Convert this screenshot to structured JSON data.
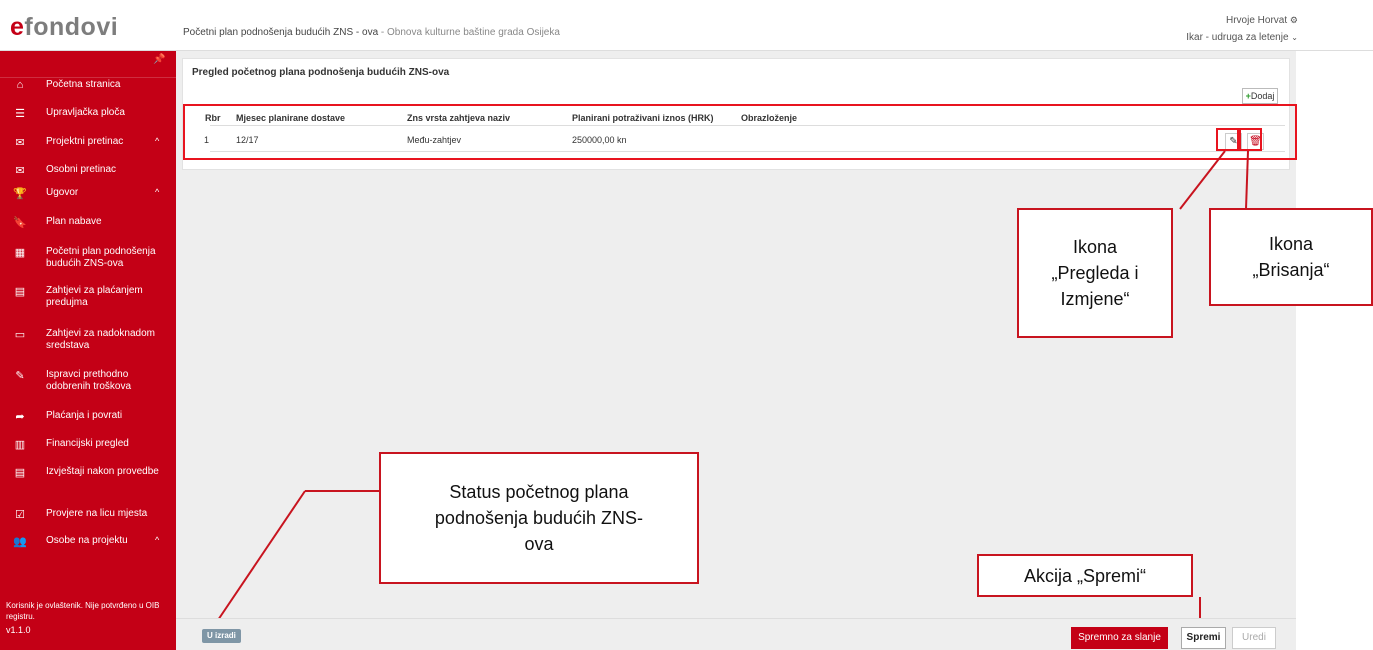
{
  "app": {
    "logo_e": "e",
    "logo_rest": "fondovi",
    "title_main": "Početni plan podnošenja budućih ZNS - ova",
    "title_sep": " - ",
    "title_project": "Obnova kulturne baštine grada Osijeka",
    "user_name": "Hrvoje Horvat",
    "user_org": "Ikar - udruga za letenje"
  },
  "sidebar": {
    "items": [
      {
        "label": "Početna stranica",
        "icon": "home-icon"
      },
      {
        "label": "Upravljačka ploča",
        "icon": "list-icon"
      },
      {
        "label": "Projektni pretinac",
        "icon": "envelope-icon",
        "chevron": "^"
      },
      {
        "label": "Osobni pretinac",
        "icon": "envelope-icon"
      },
      {
        "label": "Ugovor",
        "icon": "trophy-icon",
        "chevron": "^"
      },
      {
        "label": "Plan nabave",
        "icon": "bookmark-icon"
      },
      {
        "label": "Početni plan podnošenja budućih ZNS-ova",
        "icon": "calendar-icon"
      },
      {
        "label": "Zahtjevi za plaćanjem predujma",
        "icon": "document-icon"
      },
      {
        "label": "Zahtjevi za nadoknadom sredstava",
        "icon": "credit-card-icon"
      },
      {
        "label": "Ispravci prethodno odobrenih troškova",
        "icon": "edit-icon"
      },
      {
        "label": "Plaćanja i povrati",
        "icon": "share-icon"
      },
      {
        "label": "Financijski pregled",
        "icon": "bar-chart-icon"
      },
      {
        "label": "Izvještaji nakon provedbe",
        "icon": "report-icon"
      },
      {
        "label": "Provjere na licu mjesta",
        "icon": "checkbox-icon"
      },
      {
        "label": "Osobe na projektu",
        "icon": "users-icon",
        "chevron": "^"
      }
    ],
    "note": "Korisnik je ovlaštenik. Nije potvrđeno u OIB registru.",
    "version": "v1.1.0"
  },
  "main": {
    "panel_title": "Pregled početnog plana podnošenja budućih ZNS-ova",
    "add_label": "Dodaj",
    "columns": [
      "Rbr",
      "Mjesec planirane dostave",
      "Zns vrsta zahtjeva naziv",
      "Planirani potraživani iznos (HRK)",
      "Obrazloženje"
    ],
    "rows": [
      {
        "rbr": "1",
        "month": "12/17",
        "type": "Među-zahtjev",
        "amount": "250000,00 kn",
        "reason": ""
      }
    ]
  },
  "callouts": {
    "edit_icon": [
      "Ikona",
      "„Pregleda i",
      "Izmjene“"
    ],
    "delete_icon": [
      "Ikona",
      "„Brisanja“"
    ],
    "status": [
      "Status početnog plana",
      "podnošenja budućih ZNS-",
      "ova"
    ],
    "save_action": "Akcija „Spremi“"
  },
  "footer": {
    "status_badge": "U izradi",
    "ready_label": "Spremno za slanje",
    "save_label": "Spremi",
    "edit_label": "Uredi"
  },
  "colors": {
    "brand_red": "#c40016",
    "highlight_red": "#e8141f",
    "status_badge": "#7f96a6"
  }
}
